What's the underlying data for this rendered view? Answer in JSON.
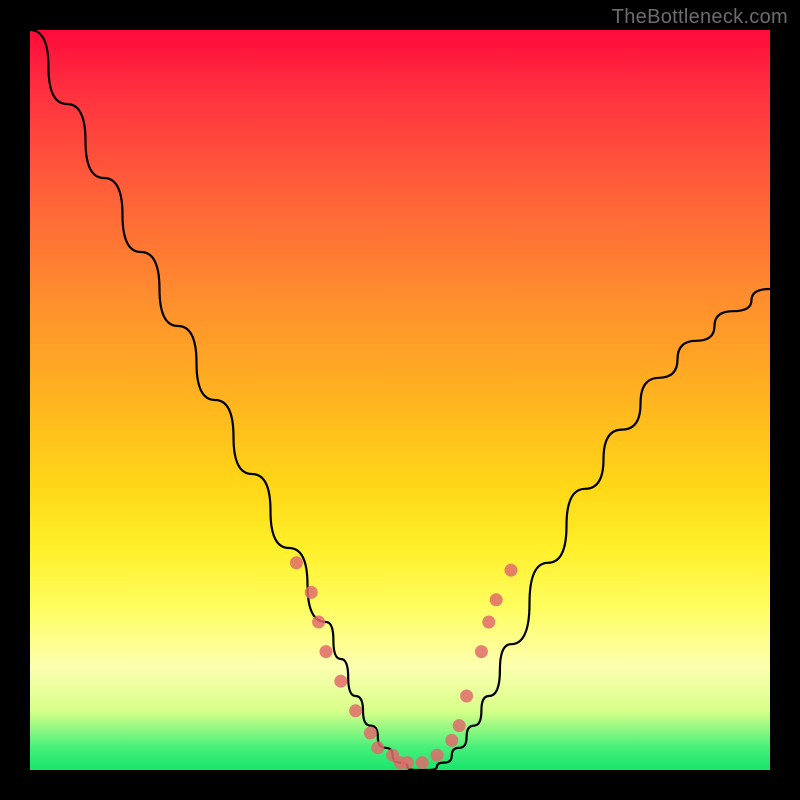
{
  "watermark": "TheBottleneck.com",
  "chart_data": {
    "type": "line",
    "title": "",
    "xlabel": "",
    "ylabel": "",
    "xlim": [
      0,
      100
    ],
    "ylim": [
      0,
      100
    ],
    "series": [
      {
        "name": "curve",
        "x": [
          0,
          5,
          10,
          15,
          20,
          25,
          30,
          35,
          40,
          42,
          44,
          46,
          48,
          50,
          52,
          54,
          56,
          58,
          60,
          62,
          65,
          70,
          75,
          80,
          85,
          90,
          95,
          100
        ],
        "y": [
          100,
          90,
          80,
          70,
          60,
          50,
          40,
          30,
          20,
          15,
          10,
          6,
          3,
          1,
          0,
          0,
          1,
          3,
          6,
          10,
          17,
          28,
          38,
          46,
          53,
          58,
          62,
          65
        ]
      }
    ],
    "markers": {
      "name": "dots",
      "x": [
        36,
        38,
        39,
        40,
        42,
        44,
        46,
        47,
        49,
        50,
        51,
        53,
        55,
        57,
        58,
        59,
        61,
        62,
        63,
        65
      ],
      "y": [
        28,
        24,
        20,
        16,
        12,
        8,
        5,
        3,
        2,
        1,
        1,
        1,
        2,
        4,
        6,
        10,
        16,
        20,
        23,
        27
      ]
    },
    "gradient_stops": [
      {
        "pos": 0,
        "color": "#ff0a3a"
      },
      {
        "pos": 8,
        "color": "#ff2f3f"
      },
      {
        "pos": 20,
        "color": "#ff5a3a"
      },
      {
        "pos": 35,
        "color": "#ff8a2f"
      },
      {
        "pos": 50,
        "color": "#ffb41f"
      },
      {
        "pos": 62,
        "color": "#ffd817"
      },
      {
        "pos": 70,
        "color": "#fff02a"
      },
      {
        "pos": 78,
        "color": "#fffd60"
      },
      {
        "pos": 86,
        "color": "#fdffb0"
      },
      {
        "pos": 92,
        "color": "#d8ff8a"
      },
      {
        "pos": 97,
        "color": "#46f07a"
      },
      {
        "pos": 100,
        "color": "#19e56b"
      }
    ]
  }
}
